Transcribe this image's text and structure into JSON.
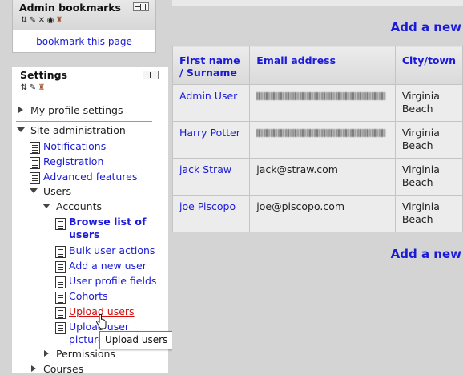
{
  "bookmarks_block": {
    "title": "Admin bookmarks",
    "link": "bookmark this page"
  },
  "settings_block": {
    "title": "Settings",
    "my_profile": "My profile settings",
    "site_admin": "Site administration",
    "notifications": "Notifications",
    "registration": "Registration",
    "advanced_features": "Advanced features",
    "users": "Users",
    "accounts": "Accounts",
    "browse_line1": "Browse list of",
    "browse_line2": "users",
    "bulk_actions": "Bulk user actions",
    "add_user": "Add a new user",
    "profile_fields": "User profile fields",
    "cohorts": "Cohorts",
    "upload_users": "Upload users",
    "upload_pics_line1": "Upload user",
    "upload_pics_line2": "pictures",
    "permissions": "Permissions",
    "courses": "Courses"
  },
  "tooltip": "Upload users",
  "main": {
    "add_new_top": "Add a new",
    "add_new_bottom": "Add a new",
    "table": {
      "headers": [
        "First name / Surname",
        "Email address",
        "City/town"
      ],
      "rows": [
        {
          "name": "Admin User",
          "email": "",
          "city": "Virginia Beach"
        },
        {
          "name": "Harry Potter",
          "email": "",
          "city": "Virginia Beach"
        },
        {
          "name": "jack Straw",
          "email": "jack@straw.com",
          "city": "Virginia Beach"
        },
        {
          "name": "joe Piscopo",
          "email": "joe@piscopo.com",
          "city": "Virginia Beach"
        }
      ]
    }
  },
  "icons": {
    "move": "move-icon",
    "edit": "edit-icon",
    "delete": "delete-icon",
    "hide": "eye-icon",
    "roles": "roles-icon",
    "dock": "dock-icon"
  }
}
